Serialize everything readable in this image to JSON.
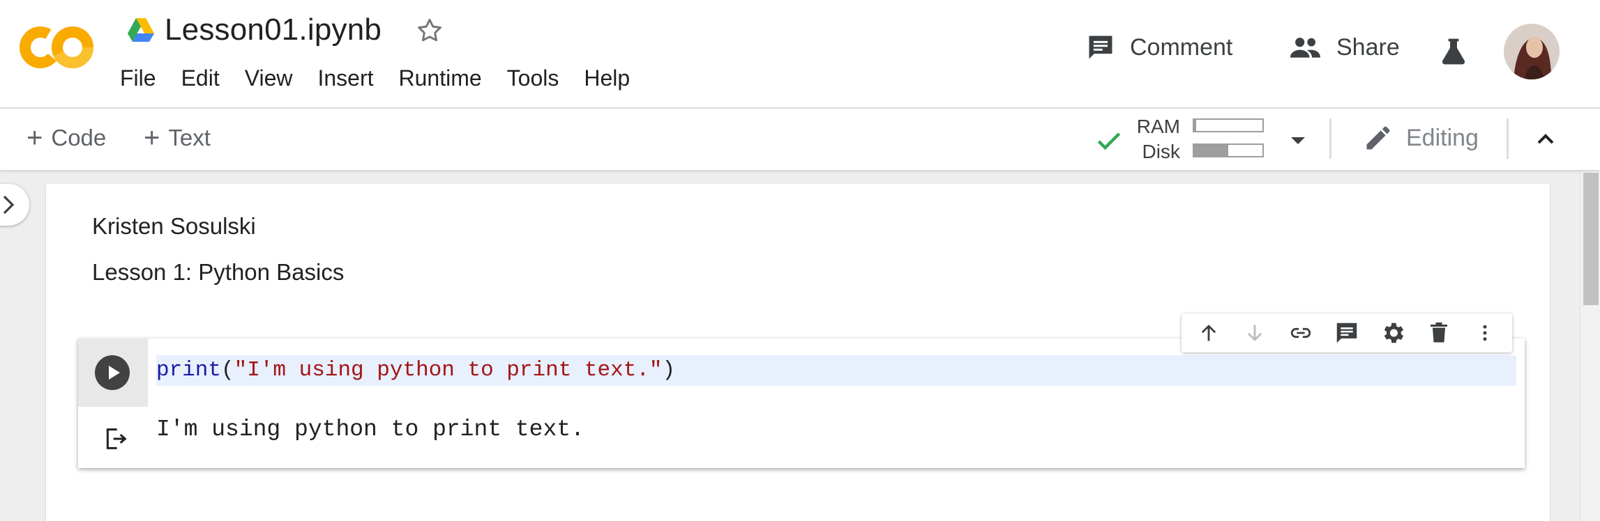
{
  "header": {
    "title": "Lesson01.ipynb",
    "logo_text": "CO",
    "menu": [
      "File",
      "Edit",
      "View",
      "Insert",
      "Runtime",
      "Tools",
      "Help"
    ],
    "comment_label": "Comment",
    "share_label": "Share"
  },
  "toolbar": {
    "add_code_label": "Code",
    "add_text_label": "Text",
    "ram_label": "RAM",
    "disk_label": "Disk",
    "ram_usage": 0.03,
    "disk_usage": 0.5,
    "editing_label": "Editing"
  },
  "notebook": {
    "text_cell": {
      "line1": "Kristen Sosulski",
      "line2": "Lesson 1: Python Basics"
    },
    "code_cell": {
      "code_func": "print",
      "code_open": "(",
      "code_string": "\"I'm using python to print text.\"",
      "code_close": ")",
      "output": "I'm using python to print text."
    }
  },
  "colors": {
    "accent_check": "#34a853",
    "logo_yellow": "#f9ab00",
    "code_highlight": "#e8f0fe"
  }
}
